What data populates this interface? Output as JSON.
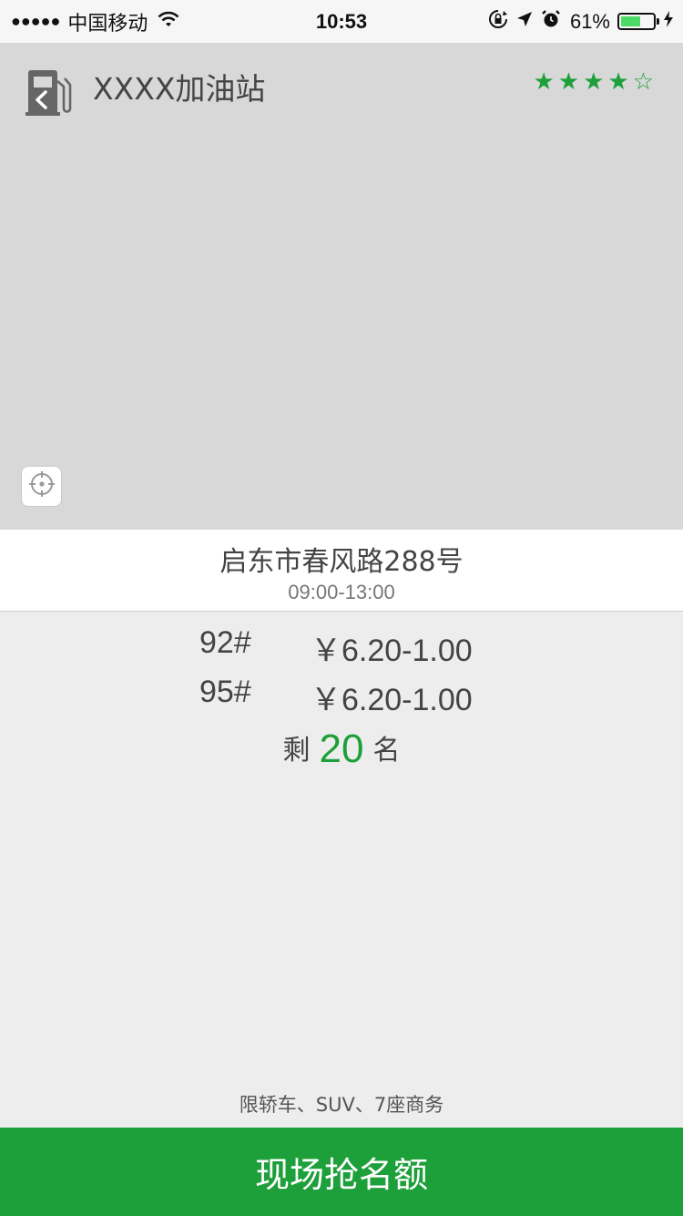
{
  "status_bar": {
    "signal": "●●●●●",
    "carrier": "中国移动",
    "time": "10:53",
    "battery_percent": "61%",
    "battery_level": 0.61
  },
  "header": {
    "station_name": "XXXX加油站",
    "rating": "★★★★☆",
    "rating_value": 4,
    "rating_max": 5
  },
  "address": {
    "street": "启东市春风路288号",
    "hours": "09:00-13:00"
  },
  "prices": [
    {
      "grade": "92#",
      "price": "￥6.20-1.00"
    },
    {
      "grade": "95#",
      "price": "￥6.20-1.00"
    }
  ],
  "remaining": {
    "prefix": "剩",
    "count": "20",
    "suffix": "名"
  },
  "restriction": "限轿车、SUV、7座商务",
  "action_button": "现场抢名额",
  "colors": {
    "accent": "#1d9f3a",
    "map_bg": "#d8d8d8",
    "page_bg": "#ededed"
  }
}
